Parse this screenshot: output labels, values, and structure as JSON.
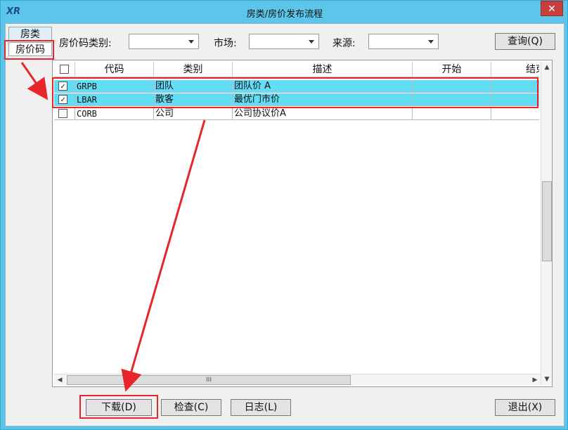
{
  "window": {
    "title": "房类/房价发布流程",
    "close_label": "✕",
    "logo": "XR"
  },
  "side_tabs": [
    {
      "label": "房类"
    },
    {
      "label": "房价码"
    }
  ],
  "filters": {
    "rate_type_label": "房价码类别:",
    "market_label": "市场:",
    "source_label": "来源:",
    "rate_type_value": "",
    "market_value": "",
    "source_value": ""
  },
  "buttons": {
    "query": "查询(Q)",
    "download": "下载(D)",
    "check": "检查(C)",
    "log": "日志(L)",
    "exit": "退出(X)"
  },
  "grid": {
    "columns": [
      "",
      "代码",
      "类别",
      "描述",
      "开始",
      "结束"
    ],
    "rows": [
      {
        "checked": "✓",
        "code": "GRPB",
        "category": "团队",
        "description": "团队价 A",
        "start": "",
        "end": "",
        "selected": true
      },
      {
        "checked": "✓",
        "code": "LBAR",
        "category": "散客",
        "description": "最优门市价",
        "start": "",
        "end": "",
        "selected": true
      },
      {
        "checked": "",
        "code": "CORB",
        "category": "公司",
        "description": "公司协议价A",
        "start": "",
        "end": "",
        "selected": false
      }
    ]
  },
  "scroll": {
    "hscroll_grip": "III"
  },
  "colors": {
    "title_bar": "#5bc6ea",
    "selection": "#63dcf5",
    "annotation": "#e8262a"
  }
}
